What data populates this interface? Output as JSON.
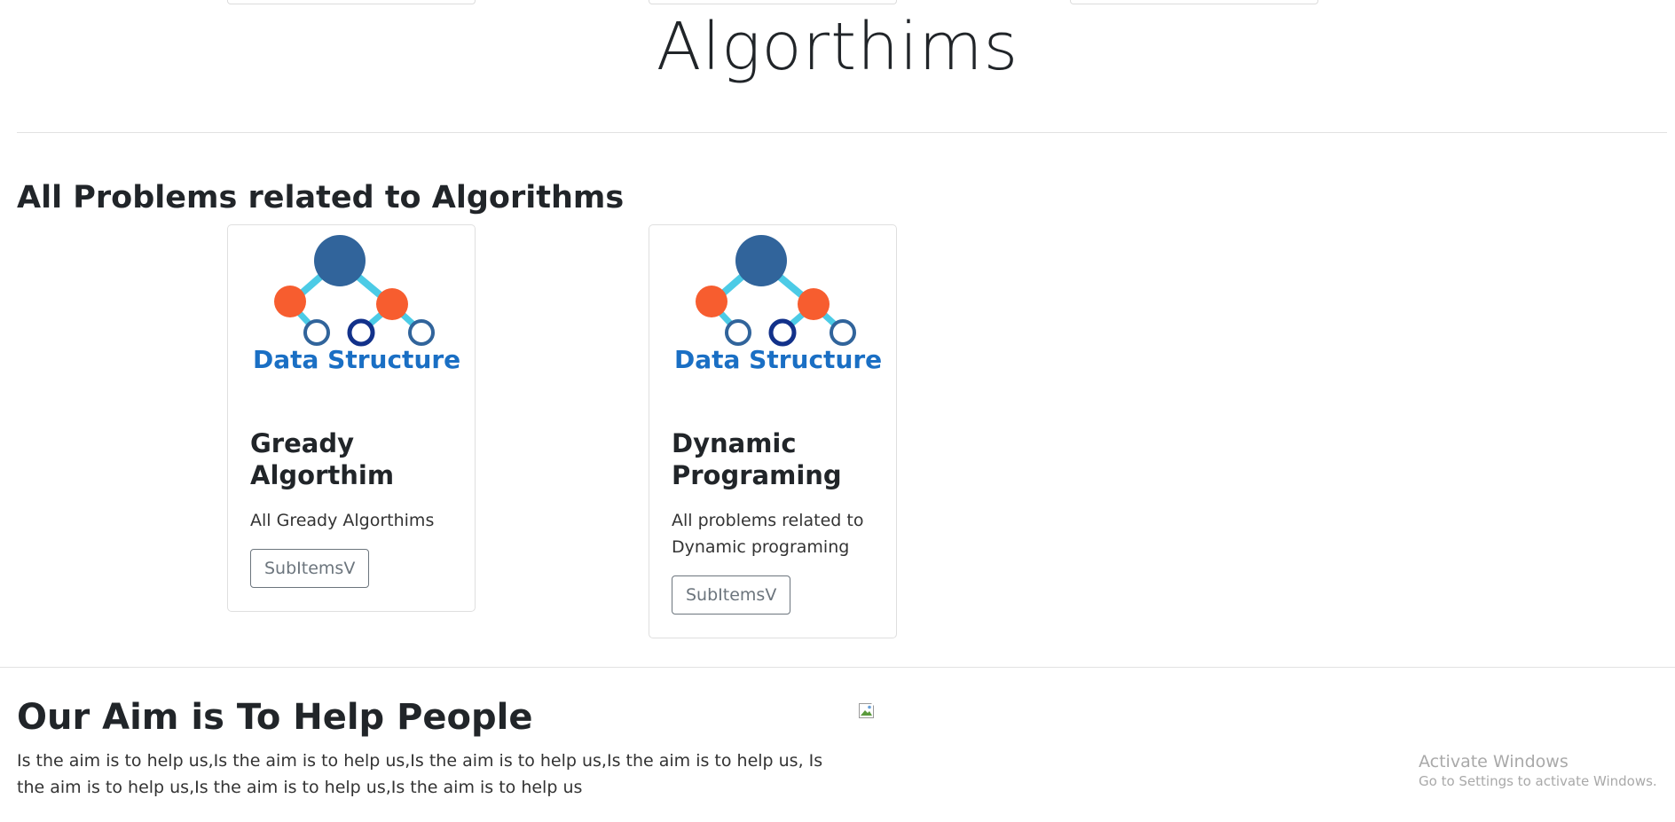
{
  "page": {
    "title": "Algorthims"
  },
  "problems": {
    "heading": "All Problems related to Algorithms",
    "cards": [
      {
        "image_caption": "Data Structure",
        "title": "Gready Algorthim",
        "text": "All Gready Algorthims",
        "button_label": "SubItemsV"
      },
      {
        "image_caption": "Data Structure",
        "title": "Dynamic Programing",
        "text": "All problems related to Dynamic programing",
        "button_label": "SubItemsV"
      }
    ]
  },
  "aim": {
    "heading": "Our Aim is To Help People",
    "text": "Is the aim is to help us,Is the aim is to help us,Is the aim is to help us,Is the aim is to help us, Is the aim is to help us,Is the aim is to help us,Is the aim is to help us"
  },
  "watermark": {
    "title": "Activate Windows",
    "subtitle": "Go to Settings to activate Windows."
  },
  "colors": {
    "node_primary": "#31649b",
    "node_secondary": "#f75d2f",
    "edge": "#4ccbe6",
    "caption": "#1a6fc4"
  }
}
